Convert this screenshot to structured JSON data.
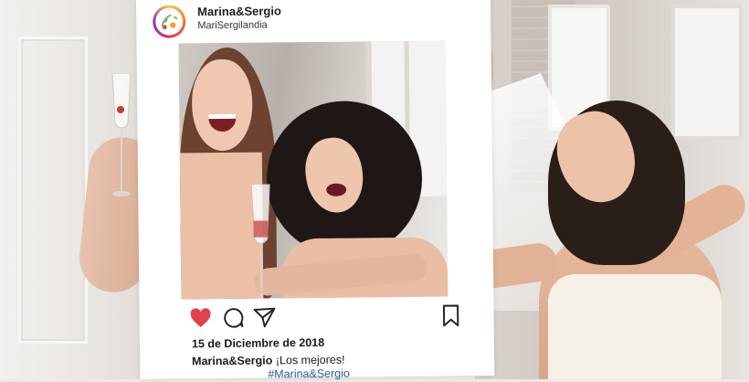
{
  "post": {
    "username": "Marina&Sergio",
    "handle": "MariSergilandia",
    "date": "15 de Diciembre de 2018",
    "caption_user": "Marina&Sergio",
    "caption_text": "¡Los mejores!",
    "hashtag": "#Marina&Sergio"
  },
  "icons": [
    "heart-icon",
    "comment-icon",
    "send-icon",
    "bookmark-icon"
  ],
  "colors": {
    "heart": "#e0424c",
    "hashtag": "#2a5a9a",
    "frame": "#ffffff"
  }
}
